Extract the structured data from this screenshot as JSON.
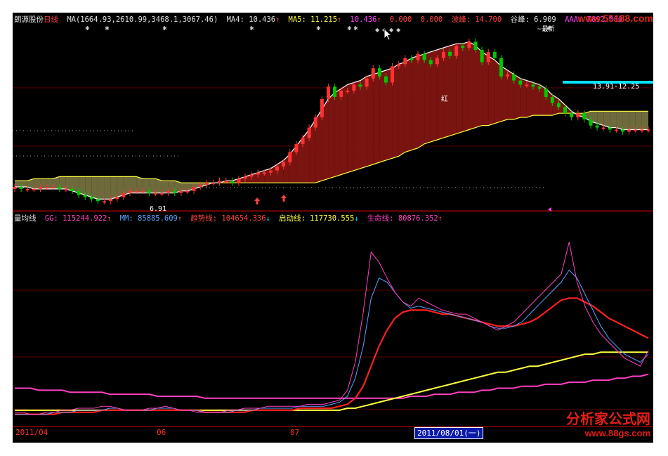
{
  "colors": {
    "up": "#ff3232",
    "down": "#00c800",
    "ma_white": "#ffffff",
    "ma_yellow": "#ffff40",
    "fill_dark_red": "#7a1410",
    "fill_olive": "#6e6a3c",
    "cyan": "#00e0ff",
    "magenta": "#ff40c0",
    "blue": "#5aa0ff"
  },
  "price_panel": {
    "stock_name": "朗源股份",
    "period": "日线",
    "ma_label": "MA(1664.93,2610.99,3468.1,3067.46)",
    "ma4": "MA4: 10.436",
    "ma5": "MA5: 11.215",
    "v3": "10.436",
    "v4": "0.000",
    "v5": "0.000",
    "boflag": "波峰: 14.700",
    "gufeng": "谷峰: 6.909",
    "aaa": "AAA: 7892.000",
    "low_label": "6.91",
    "hong_label": "红",
    "range_label": "13.91-12.25",
    "top_label": "~最新"
  },
  "volume_panel": {
    "name": "量均线",
    "gg": "GG: 115244.922",
    "mm": "MM: 85885.609",
    "trend": "趋势线: 104654.336",
    "start": "启动线: 117730.555",
    "life": "生命线: 80876.352"
  },
  "date_axis": {
    "labels": [
      "2011/04",
      "06",
      "07"
    ],
    "selected": "2011/08/01(一)"
  },
  "watermark": {
    "url": "www.55188.com",
    "brand": "分析家公式网",
    "site": "www.88gs.com"
  },
  "chart_data": {
    "type": "line",
    "x": [
      0,
      1,
      2,
      3,
      4,
      5,
      6,
      7,
      8,
      9,
      10,
      11,
      12,
      13,
      14,
      15,
      16,
      17,
      18,
      19,
      20,
      21,
      22,
      23,
      24,
      25,
      26,
      27,
      28,
      29,
      30,
      31,
      32,
      33,
      34,
      35,
      36,
      37,
      38,
      39,
      40,
      41,
      42,
      43,
      44,
      45,
      46,
      47,
      48,
      49,
      50,
      51,
      52,
      53,
      54,
      55,
      56,
      57,
      58,
      59,
      60,
      61,
      62,
      63,
      64,
      65,
      66,
      67,
      68,
      69,
      70,
      71,
      72,
      73,
      74,
      75,
      76,
      77,
      78,
      79,
      80,
      81,
      82,
      83,
      84,
      85,
      86,
      87,
      88,
      89,
      90,
      91,
      92,
      93,
      94,
      95,
      96,
      97,
      98,
      99
    ],
    "candles_close": [
      7.6,
      7.5,
      7.5,
      7.5,
      7.6,
      7.6,
      7.6,
      7.5,
      7.5,
      7.4,
      7.2,
      7.1,
      7.0,
      6.9,
      6.9,
      7.0,
      7.1,
      7.3,
      7.4,
      7.4,
      7.4,
      7.3,
      7.3,
      7.3,
      7.4,
      7.3,
      7.4,
      7.4,
      7.6,
      7.7,
      7.8,
      7.8,
      7.9,
      7.9,
      7.8,
      8.0,
      8.1,
      8.2,
      8.3,
      8.3,
      8.4,
      8.6,
      8.8,
      9.3,
      9.7,
      10.0,
      10.5,
      11.0,
      11.9,
      12.5,
      12.0,
      12.3,
      12.3,
      12.6,
      12.5,
      12.9,
      13.4,
      13.0,
      12.7,
      13.5,
      13.6,
      13.9,
      13.8,
      14.1,
      13.8,
      13.6,
      13.9,
      14.2,
      14.0,
      14.5,
      14.4,
      14.7,
      14.3,
      13.7,
      14.2,
      13.9,
      13.0,
      13.1,
      12.8,
      12.6,
      12.6,
      12.5,
      12.4,
      12.0,
      11.7,
      11.5,
      11.2,
      11.0,
      11.2,
      10.9,
      10.6,
      10.5,
      10.5,
      10.4,
      10.4,
      10.3,
      10.4,
      10.4,
      10.4,
      10.4
    ],
    "candles_open": [
      7.5,
      7.6,
      7.5,
      7.5,
      7.5,
      7.6,
      7.6,
      7.6,
      7.5,
      7.5,
      7.4,
      7.2,
      7.1,
      7.0,
      6.9,
      6.9,
      7.0,
      7.1,
      7.3,
      7.4,
      7.4,
      7.4,
      7.3,
      7.3,
      7.3,
      7.4,
      7.3,
      7.4,
      7.4,
      7.6,
      7.7,
      7.8,
      7.8,
      7.9,
      7.9,
      7.8,
      8.0,
      8.1,
      8.2,
      8.3,
      8.3,
      8.4,
      8.6,
      8.8,
      9.3,
      9.7,
      10.0,
      10.5,
      11.0,
      11.9,
      12.5,
      12.0,
      12.3,
      12.3,
      12.6,
      12.5,
      12.9,
      13.4,
      13.0,
      12.7,
      13.5,
      13.6,
      13.9,
      13.8,
      14.1,
      13.8,
      13.6,
      13.9,
      14.2,
      14.0,
      14.5,
      14.4,
      14.7,
      14.3,
      13.7,
      14.2,
      13.9,
      13.0,
      13.1,
      12.8,
      12.6,
      12.6,
      12.5,
      12.4,
      12.0,
      11.7,
      11.5,
      11.2,
      11.0,
      11.2,
      10.9,
      10.6,
      10.5,
      10.5,
      10.4,
      10.4,
      10.3,
      10.4,
      10.4,
      10.4
    ],
    "ma_white": [
      7.6,
      7.6,
      7.6,
      7.5,
      7.5,
      7.5,
      7.5,
      7.5,
      7.5,
      7.4,
      7.3,
      7.2,
      7.1,
      7.0,
      7.0,
      7.0,
      7.1,
      7.2,
      7.3,
      7.3,
      7.3,
      7.3,
      7.3,
      7.3,
      7.3,
      7.3,
      7.4,
      7.4,
      7.5,
      7.6,
      7.7,
      7.8,
      7.8,
      7.9,
      7.9,
      8.0,
      8.1,
      8.2,
      8.3,
      8.4,
      8.5,
      8.7,
      8.9,
      9.2,
      9.6,
      10.0,
      10.4,
      10.9,
      11.4,
      11.9,
      12.2,
      12.4,
      12.6,
      12.7,
      12.8,
      13.0,
      13.1,
      13.2,
      13.3,
      13.4,
      13.6,
      13.7,
      13.9,
      14.0,
      14.1,
      14.2,
      14.3,
      14.4,
      14.5,
      14.6,
      14.6,
      14.7,
      14.5,
      14.2,
      14.0,
      13.8,
      13.5,
      13.3,
      13.1,
      12.9,
      12.8,
      12.7,
      12.6,
      12.4,
      12.1,
      11.9,
      11.6,
      11.3,
      11.1,
      11.0,
      10.8,
      10.7,
      10.6,
      10.5,
      10.5,
      10.4,
      10.4,
      10.4,
      10.4,
      10.4
    ],
    "ma_yellow": [
      7.9,
      7.9,
      7.9,
      8.0,
      8.0,
      8.0,
      8.0,
      8.1,
      8.1,
      8.1,
      8.1,
      8.1,
      8.1,
      8.1,
      8.1,
      8.1,
      8.1,
      8.1,
      8.1,
      8.1,
      8.0,
      8.0,
      8.0,
      7.9,
      7.9,
      7.9,
      7.8,
      7.8,
      7.8,
      7.8,
      7.8,
      7.8,
      7.8,
      7.8,
      7.8,
      7.8,
      7.8,
      7.8,
      7.8,
      7.8,
      7.8,
      7.8,
      7.8,
      7.8,
      7.8,
      7.8,
      7.8,
      7.8,
      7.9,
      8.0,
      8.1,
      8.2,
      8.3,
      8.4,
      8.5,
      8.6,
      8.7,
      8.8,
      8.9,
      9.0,
      9.1,
      9.3,
      9.4,
      9.5,
      9.7,
      9.8,
      9.9,
      10.0,
      10.1,
      10.2,
      10.3,
      10.4,
      10.5,
      10.6,
      10.6,
      10.7,
      10.8,
      10.9,
      10.9,
      11.0,
      11.0,
      11.1,
      11.1,
      11.1,
      11.1,
      11.2,
      11.2,
      11.2,
      11.2,
      11.2,
      11.3,
      11.3,
      11.3,
      11.3,
      11.3,
      11.3,
      11.3,
      11.3,
      11.3,
      11.3
    ],
    "series": [
      {
        "name": "GG",
        "values": [
          5,
          5,
          4,
          4,
          5,
          5,
          6,
          6,
          7,
          7,
          7,
          8,
          8,
          7,
          6,
          6,
          6,
          7,
          7,
          8,
          7,
          6,
          6,
          5,
          5,
          5,
          5,
          6,
          6,
          7,
          7,
          7,
          8,
          8,
          8,
          8,
          8,
          9,
          9,
          9,
          10,
          11,
          16,
          30,
          55,
          85,
          80,
          72,
          65,
          60,
          58,
          62,
          60,
          58,
          56,
          55,
          54,
          54,
          52,
          50,
          48,
          46,
          48,
          50,
          54,
          58,
          62,
          66,
          70,
          74,
          90,
          70,
          58,
          50,
          44,
          40,
          36,
          32,
          30,
          28,
          36
        ]
      },
      {
        "name": "MM",
        "values": [
          4,
          4,
          4,
          4,
          4,
          5,
          5,
          5,
          6,
          6,
          6,
          6,
          7,
          7,
          6,
          6,
          6,
          6,
          7,
          7,
          7,
          6,
          6,
          6,
          5,
          5,
          5,
          5,
          6,
          6,
          6,
          7,
          7,
          7,
          7,
          7,
          8,
          8,
          8,
          8,
          9,
          10,
          13,
          22,
          38,
          62,
          72,
          70,
          65,
          60,
          57,
          58,
          57,
          56,
          55,
          54,
          53,
          52,
          51,
          50,
          48,
          47,
          47,
          48,
          50,
          54,
          58,
          62,
          66,
          70,
          76,
          72,
          64,
          56,
          48,
          42,
          38,
          34,
          32,
          30,
          34
        ]
      },
      {
        "name": "趋势线",
        "values": [
          4,
          4,
          4,
          4,
          4,
          4,
          5,
          5,
          5,
          5,
          5,
          6,
          6,
          6,
          6,
          6,
          6,
          6,
          6,
          6,
          6,
          6,
          6,
          6,
          5,
          5,
          5,
          5,
          5,
          5,
          6,
          6,
          6,
          6,
          6,
          6,
          7,
          7,
          7,
          7,
          7,
          8,
          9,
          12,
          18,
          28,
          38,
          46,
          52,
          55,
          56,
          56,
          56,
          55,
          54,
          54,
          53,
          52,
          51,
          50,
          49,
          48,
          48,
          48,
          49,
          50,
          52,
          55,
          58,
          61,
          62,
          62,
          60,
          58,
          55,
          52,
          50,
          48,
          46,
          44,
          42
        ]
      },
      {
        "name": "启动线",
        "values": [
          6,
          6,
          6,
          6,
          6,
          6,
          6,
          6,
          6,
          6,
          6,
          6,
          6,
          6,
          6,
          6,
          6,
          6,
          6,
          6,
          6,
          6,
          6,
          6,
          6,
          6,
          6,
          6,
          6,
          6,
          6,
          6,
          6,
          6,
          6,
          6,
          6,
          6,
          6,
          6,
          6,
          6,
          7,
          7,
          8,
          9,
          10,
          11,
          12,
          13,
          14,
          15,
          16,
          17,
          18,
          19,
          20,
          21,
          22,
          23,
          24,
          25,
          25,
          26,
          27,
          28,
          28,
          29,
          30,
          31,
          32,
          33,
          34,
          34,
          35,
          35,
          35,
          35,
          35,
          35,
          35
        ]
      },
      {
        "name": "生命线",
        "values": [
          17,
          17,
          17,
          16,
          16,
          16,
          16,
          15,
          15,
          15,
          15,
          15,
          14,
          14,
          14,
          14,
          14,
          14,
          13,
          13,
          13,
          13,
          13,
          13,
          12,
          12,
          12,
          12,
          12,
          12,
          12,
          12,
          12,
          12,
          12,
          12,
          12,
          12,
          12,
          12,
          12,
          12,
          12,
          12,
          12,
          12,
          12,
          12,
          12,
          12,
          13,
          13,
          13,
          14,
          14,
          14,
          15,
          15,
          15,
          16,
          16,
          17,
          17,
          17,
          18,
          18,
          18,
          19,
          19,
          19,
          20,
          20,
          20,
          21,
          21,
          21,
          22,
          22,
          23,
          23,
          24
        ]
      }
    ]
  }
}
